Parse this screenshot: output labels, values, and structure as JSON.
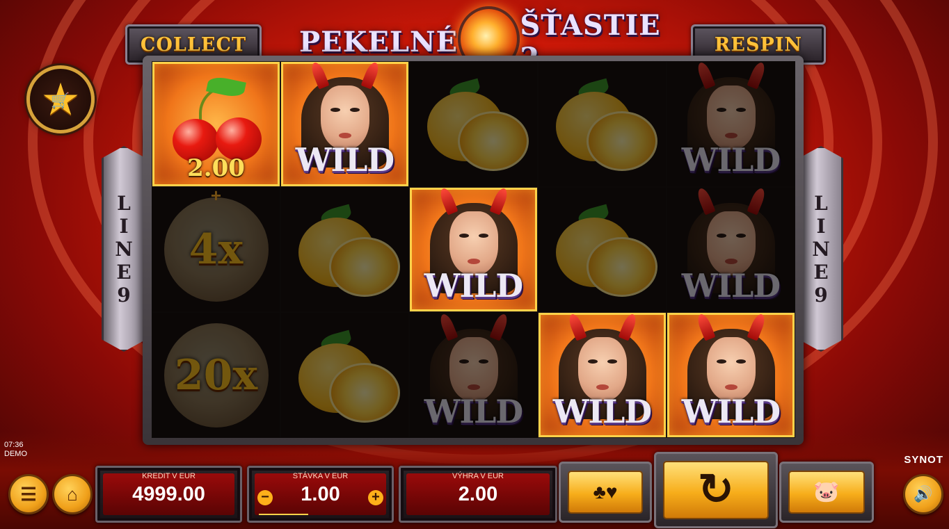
{
  "header": {
    "title_left": "PEKELNÉ",
    "title_right": "ŠŤASTIE 2",
    "collect_label": "COLLECT",
    "respin_label": "RESPIN"
  },
  "side_banners": {
    "left": [
      "L",
      "I",
      "N",
      "E",
      "9"
    ],
    "right": [
      "L",
      "I",
      "N",
      "E",
      "9"
    ]
  },
  "reels": {
    "cherry_win": "2.00",
    "multipliers": [
      "4x",
      "20x"
    ],
    "wild_label": "WILD"
  },
  "status": {
    "time": "07:36",
    "mode": "DEMO",
    "brand": "SYNOT"
  },
  "panels": {
    "credit": {
      "caption": "KREDIT V EUR",
      "value": "4999.00"
    },
    "stake": {
      "caption": "STÁVKA V EUR",
      "value": "1.00",
      "minus": "−",
      "plus": "+"
    },
    "win": {
      "caption": "VÝHRA V EUR",
      "value": "2.00"
    }
  },
  "icons": {
    "menu": "☰",
    "home": "⌂",
    "star": "★",
    "cart": "🛒",
    "cards": "♣♥",
    "spin": "↻",
    "piggy": "🐷",
    "sound": "🔊"
  },
  "colors": {
    "accent": "#ffc23a",
    "panel_red": "#9a0a0a"
  }
}
